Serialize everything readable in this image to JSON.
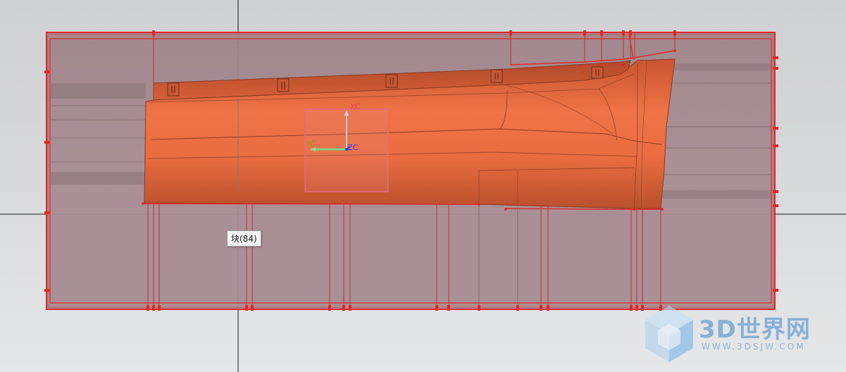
{
  "tooltip": {
    "text": "块(84)"
  },
  "triad": {
    "xc": "XC",
    "yc": "YC",
    "zc": "ZC"
  },
  "watermark": {
    "title": "3D世界网",
    "url": "WWW.3DSJW.COM"
  },
  "colors": {
    "background": "#d6d7d9",
    "block_fill": "#a48a90",
    "block_outline": "#e02a2a",
    "part_fill": "#e8653a",
    "part_dark": "#b84d2b",
    "selection_box": "#e26a8a",
    "watermark": "#4a8fd0"
  },
  "icons": [
    "view-triad-icon",
    "watermark-cube-icon"
  ]
}
